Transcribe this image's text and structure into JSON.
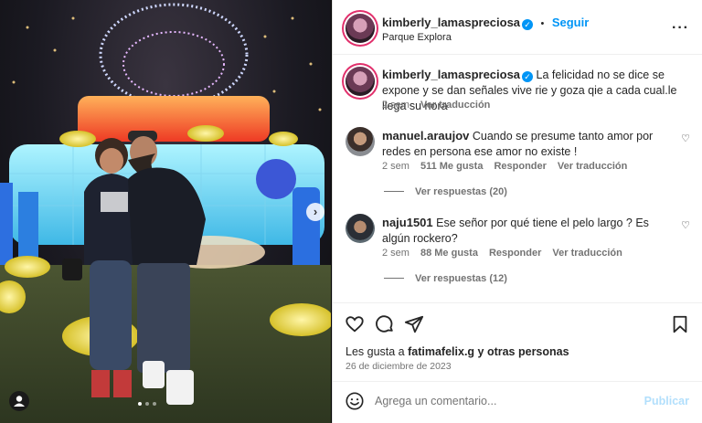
{
  "post": {
    "username": "kimberly_lamaspreciosa",
    "location": "Parque Explora",
    "follow_label": "Seguir",
    "separator": "•",
    "caption": "La felicidad no se dice se expone y se dan señales vive rie y goza qie a cada cual.le llega su hora",
    "caption_time": "2 sem",
    "caption_translate": "Ver traducción",
    "likes_prefix": "Les gusta a ",
    "likes_user": "fatimafelix.g",
    "likes_suffix": " y otras personas",
    "date": "26 de diciembre de 2023"
  },
  "comments": [
    {
      "username": "manuel.araujov",
      "text": "Cuando se presume tanto amor por redes en persona ese amor no existe !",
      "time": "2 sem",
      "likes": "511 Me gusta",
      "reply": "Responder",
      "translate": "Ver traducción",
      "view_replies": "Ver respuestas (20)"
    },
    {
      "username": "naju1501",
      "text": "Ese señor por qué tiene el pelo largo ? Es algún rockero?",
      "time": "2 sem",
      "likes": "88 Me gusta",
      "reply": "Responder",
      "translate": "Ver traducción",
      "view_replies": "Ver respuestas (12)"
    }
  ],
  "comment_box": {
    "placeholder": "Agrega un comentario...",
    "publish_label": "Publicar"
  },
  "carousel": {
    "dot_count": 3,
    "active_dot": 1
  }
}
